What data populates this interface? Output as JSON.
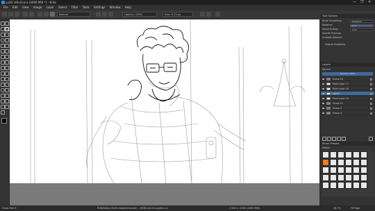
{
  "window": {
    "title": "yaD3 (40x4).kra [4000 MiB *] – Krita",
    "controls": [
      "—",
      "❐",
      "✕"
    ]
  },
  "menu": [
    "File",
    "Edit",
    "View",
    "Image",
    "Layer",
    "Select",
    "Filter",
    "Tools",
    "Settings",
    "Window",
    "Help"
  ],
  "toolbar": {
    "blend_mode": "Normal",
    "opacity": "Opacity: 100%",
    "size": "Size: 6.15 px"
  },
  "tool_options": {
    "title": "Tool Options",
    "rows": [
      {
        "label": "Brush Smoothing:",
        "value": "Weighted"
      },
      {
        "label": "Distance:",
        "value": "50.0"
      },
      {
        "label": "Stroke Ending:",
        "value": "0.15"
      },
      {
        "label": "Smooth Pressure",
        "value": ""
      },
      {
        "label": "Scalable Distance",
        "value": ""
      },
      {
        "label": "Snap to Assistants",
        "value": ""
      }
    ]
  },
  "layers": {
    "title": "Layers",
    "mode": "Normal",
    "opacity": "Opacity: 100%",
    "items": [
      {
        "name": "Group 16",
        "selected": false
      },
      {
        "name": "Paint Layer 17",
        "selected": false
      },
      {
        "name": "Paint Layer 18",
        "selected": false
      },
      {
        "name": "sketch",
        "selected": true
      },
      {
        "name": "Paint Layer 19",
        "selected": false
      },
      {
        "name": "Group 15",
        "selected": false
      },
      {
        "name": "Group 3",
        "selected": false
      },
      {
        "name": "Group 4",
        "selected": false
      }
    ]
  },
  "brush_presets": {
    "title": "Brush Presets",
    "filter": "Sketch"
  },
  "status": {
    "left": "Cross Hair 8",
    "middle": "RGB/Alpha (8-bit integer/channel) – sRGB-elle-V2-srgbtrc.icc",
    "right_size": "2,500 × 4,500 (4000 MiB)",
    "zoom": "38.7%",
    "fit": "Fit Page"
  },
  "colors": {
    "accent": "#3d6a9c",
    "fg_swatch": "#ff7a1a",
    "bg_swatch": "#ffffff"
  }
}
